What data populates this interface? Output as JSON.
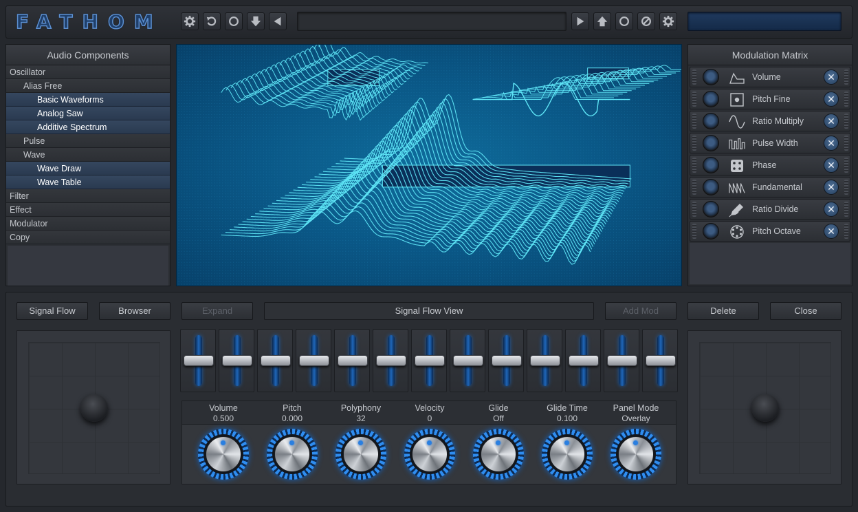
{
  "app": {
    "logo_text": "FATHOM"
  },
  "toolbar": {
    "left_icons": [
      "gear-icon",
      "undo-icon",
      "circle-icon",
      "download-arrow-icon",
      "back-arrow-icon"
    ],
    "right_icons": [
      "play-icon",
      "upload-arrow-icon",
      "circle-icon",
      "disable-icon",
      "gear-icon"
    ],
    "preset_name": ""
  },
  "components": {
    "title": "Audio Components",
    "items": [
      {
        "label": "Oscillator",
        "level": 0,
        "selected": false
      },
      {
        "label": "Alias Free",
        "level": 1,
        "selected": false
      },
      {
        "label": "Basic Waveforms",
        "level": 2,
        "selected": true
      },
      {
        "label": "Analog Saw",
        "level": 2,
        "selected": true
      },
      {
        "label": "Additive Spectrum",
        "level": 2,
        "selected": true
      },
      {
        "label": "Pulse",
        "level": 1,
        "selected": false
      },
      {
        "label": "Wave",
        "level": 1,
        "selected": false
      },
      {
        "label": "Wave Draw",
        "level": 2,
        "selected": true
      },
      {
        "label": "Wave Table",
        "level": 2,
        "selected": true
      },
      {
        "label": "Filter",
        "level": 0,
        "selected": false
      },
      {
        "label": "Effect",
        "level": 0,
        "selected": false
      },
      {
        "label": "Modulator",
        "level": 0,
        "selected": false
      },
      {
        "label": "Copy",
        "level": 0,
        "selected": false
      }
    ]
  },
  "modulation": {
    "title": "Modulation Matrix",
    "rows": [
      {
        "label": "Volume",
        "icon": "envelope-icon"
      },
      {
        "label": "Pitch Fine",
        "icon": "square-dot-icon"
      },
      {
        "label": "Ratio Multiply",
        "icon": "sine-wave-icon"
      },
      {
        "label": "Pulse Width",
        "icon": "pulse-wave-icon"
      },
      {
        "label": "Phase",
        "icon": "dice-icon"
      },
      {
        "label": "Fundamental",
        "icon": "sawtooth-wave-icon"
      },
      {
        "label": "Ratio Divide",
        "icon": "pencil-draw-icon"
      },
      {
        "label": "Pitch Octave",
        "icon": "step-sequencer-icon"
      }
    ],
    "close_glyph": "✕"
  },
  "lower": {
    "buttons": {
      "signal_flow": "Signal Flow",
      "browser": "Browser",
      "expand": "Expand",
      "add_mod": "Add Mod",
      "delete": "Delete",
      "close": "Close"
    },
    "view_title": "Signal Flow View",
    "sliders": [
      0.5,
      0.5,
      0.5,
      0.5,
      0.5,
      0.5,
      0.5,
      0.5,
      0.5,
      0.5,
      0.5,
      0.5,
      0.5
    ],
    "knobs": [
      {
        "name": "Volume",
        "value": "0.500"
      },
      {
        "name": "Pitch",
        "value": "0.000"
      },
      {
        "name": "Polyphony",
        "value": "32"
      },
      {
        "name": "Velocity",
        "value": "0"
      },
      {
        "name": "Glide",
        "value": "Off"
      },
      {
        "name": "Glide Time",
        "value": "0.100"
      },
      {
        "name": "Panel Mode",
        "value": "Overlay"
      }
    ]
  },
  "colors": {
    "accent_blue": "#2f8df0",
    "waveform": "#5fe6f7",
    "visualizer_bg": "#0a5786",
    "panel_bg": "#2b2e33"
  }
}
